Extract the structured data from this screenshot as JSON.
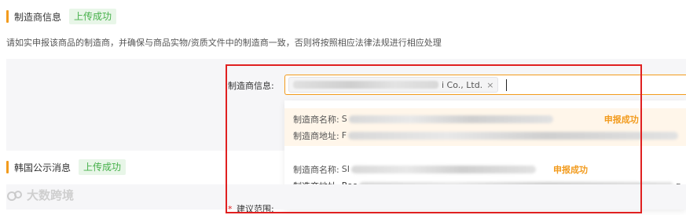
{
  "manufacturer_section": {
    "title": "制造商信息",
    "status_tag": "上传成功",
    "notice": "请如实申报该商品的制造商，并确保与商品实物/资质文件中的制造商一致，否则将按照相应法律法规进行相应处理"
  },
  "manufacturer_field": {
    "label": "制造商信息:",
    "selected_chip_suffix": "i Co., Ltd.",
    "chip_close": "×"
  },
  "dropdown": {
    "options": [
      {
        "name_label": "制造商名称:",
        "name_value": "S",
        "address_label": "制造商地址:",
        "address_value": "F",
        "status": "申报成功"
      },
      {
        "name_label": "制造商名称:",
        "name_value": "SI",
        "address_label": "制造商地址:",
        "address_value": "Roo",
        "address_tail": "g",
        "status": "申报成功"
      }
    ]
  },
  "korea_section": {
    "title": "韩国公示消息",
    "status_tag": "上传成功"
  },
  "next_field": {
    "required_mark": "*",
    "label": "建议范围:"
  },
  "watermark": {
    "text": "大数跨境"
  },
  "colors": {
    "accent": "#f29b1d",
    "success": "#46b04a",
    "highlight_frame": "#e02020"
  }
}
